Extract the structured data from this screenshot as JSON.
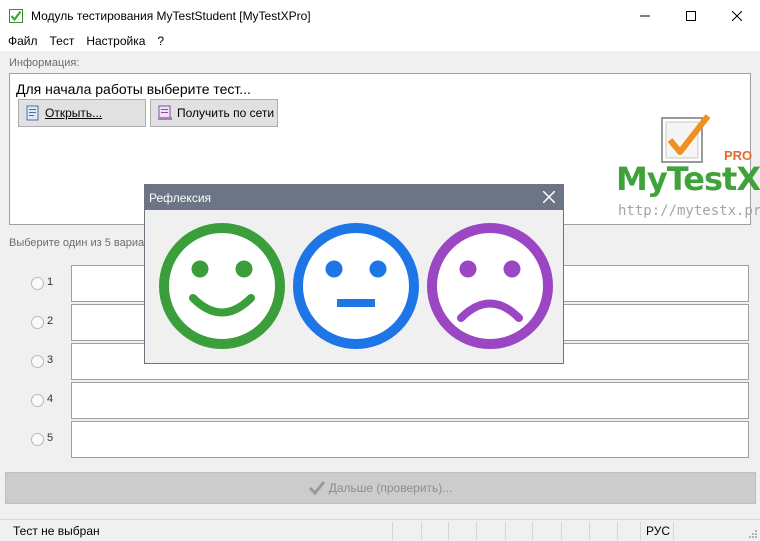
{
  "window": {
    "title": "Модуль тестирования MyTestStudent [MyTestXPro]",
    "minimize_icon": "minimize-icon",
    "maximize_icon": "maximize-icon",
    "close_icon": "close-icon"
  },
  "menu": {
    "items": [
      "Файл",
      "Тест",
      "Настройка",
      "?"
    ]
  },
  "info": {
    "label": "Информация:",
    "message": "Для начала работы выберите тест...",
    "open_button": "Открыть...",
    "network_button": "Получить по сети"
  },
  "logo": {
    "name": "MyTestX",
    "pro": "PRO",
    "url": "http://mytestx.pro"
  },
  "answers": {
    "label": "Выберите один из 5 вариа",
    "numbers": [
      "1",
      "2",
      "3",
      "4",
      "5"
    ]
  },
  "next_button": "Дальше (проверить)...",
  "status": {
    "test": "Тест не выбран",
    "lang": "РУС"
  },
  "dialog": {
    "title": "Рефлексия",
    "faces": [
      {
        "name": "happy-face",
        "color": "#3a9e3a"
      },
      {
        "name": "neutral-face",
        "color": "#1e75e6"
      },
      {
        "name": "sad-face",
        "color": "#9b47c4"
      }
    ]
  }
}
